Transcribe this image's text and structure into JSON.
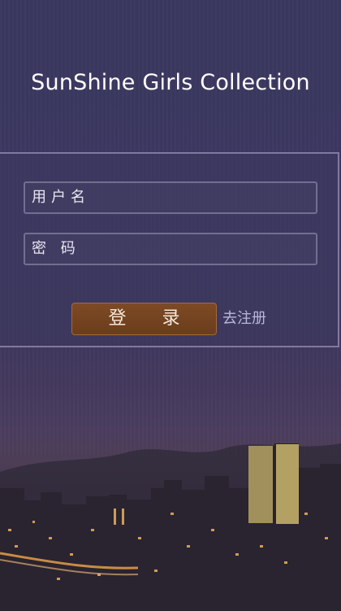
{
  "app": {
    "title": "SunShine Girls Collection"
  },
  "login_form": {
    "username_placeholder": "用户名",
    "password_placeholder": "密 码",
    "login_button_label": "登录",
    "register_link_label": "去注册"
  },
  "colors": {
    "background": "#3c3862",
    "login_button": "#7d4a24",
    "register_link": "#b9b6dc"
  }
}
